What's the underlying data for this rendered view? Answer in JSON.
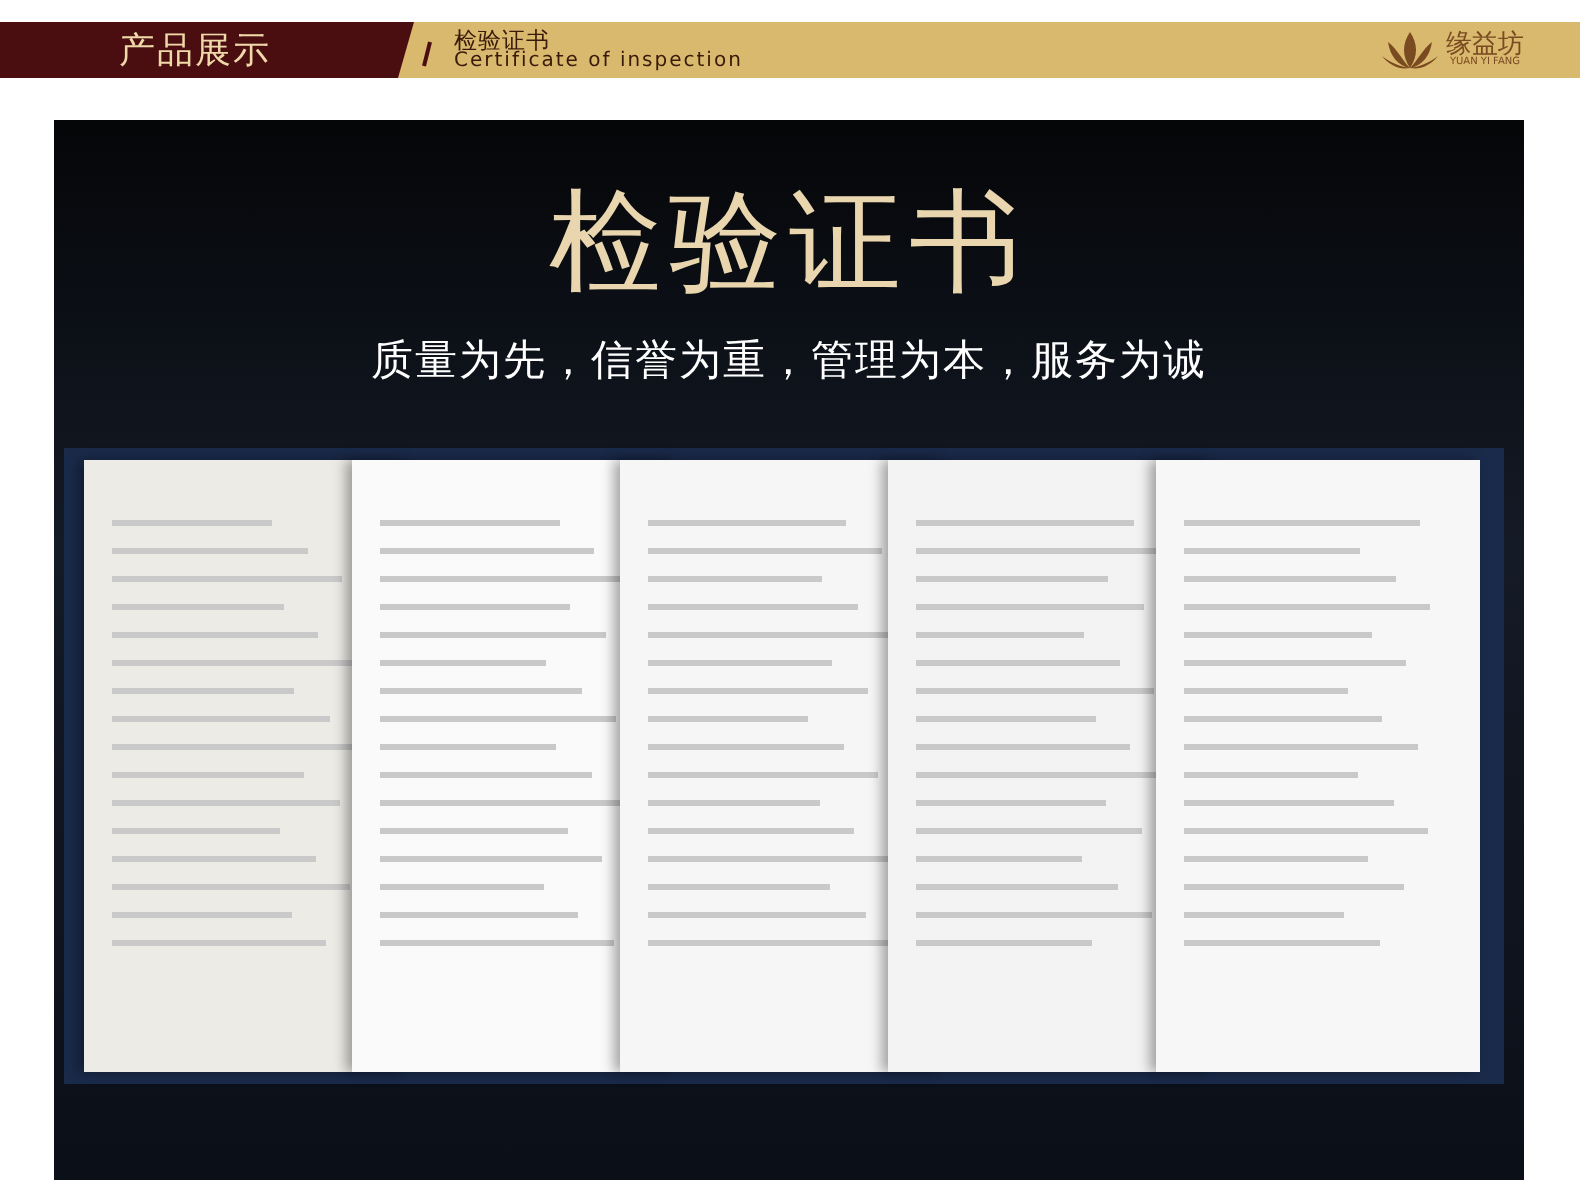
{
  "header": {
    "section": "产品展示",
    "title": "检验证书",
    "subtitle": "Certificate of inspection",
    "brand": {
      "name": "缘益坊",
      "pinyin": "YUAN YI FANG"
    }
  },
  "panel": {
    "heading": "检验证书",
    "motto": "质量为先，信誉为重，管理为本，服务为诚"
  }
}
